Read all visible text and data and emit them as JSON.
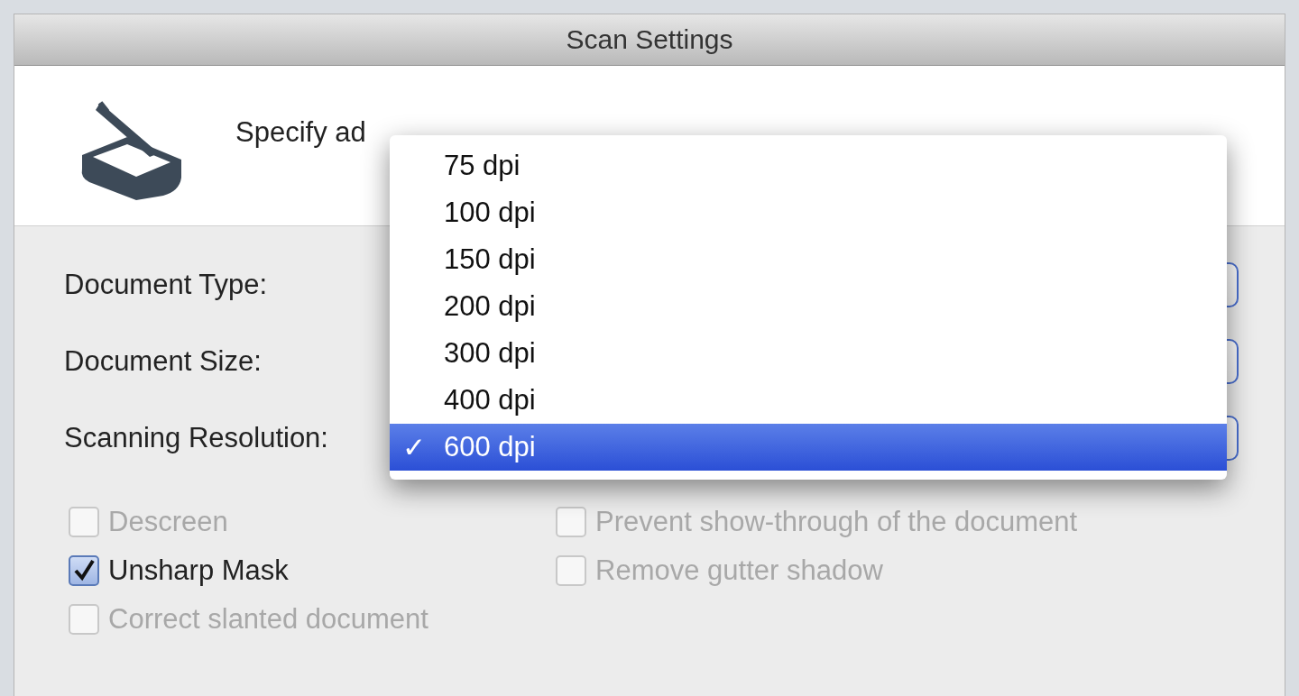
{
  "window": {
    "title": "Scan Settings"
  },
  "header": {
    "text": "Specify ad"
  },
  "settings": [
    {
      "label": "Document Type:"
    },
    {
      "label": "Document Size:"
    },
    {
      "label": "Scanning Resolution:"
    }
  ],
  "resolution_menu": [
    {
      "label": "75 dpi",
      "selected": false
    },
    {
      "label": "100 dpi",
      "selected": false
    },
    {
      "label": "150 dpi",
      "selected": false
    },
    {
      "label": "200 dpi",
      "selected": false
    },
    {
      "label": "300 dpi",
      "selected": false
    },
    {
      "label": "400 dpi",
      "selected": false
    },
    {
      "label": "600 dpi",
      "selected": true,
      "checkmark": "✓"
    }
  ],
  "options": [
    {
      "label": "Descreen",
      "checked": false,
      "disabled": true
    },
    {
      "label": "Prevent show-through of the document",
      "checked": false,
      "disabled": true
    },
    {
      "label": "Unsharp Mask",
      "checked": true,
      "disabled": false
    },
    {
      "label": "Remove gutter shadow",
      "checked": false,
      "disabled": true
    },
    {
      "label": "Correct slanted document",
      "checked": false,
      "disabled": true
    }
  ]
}
